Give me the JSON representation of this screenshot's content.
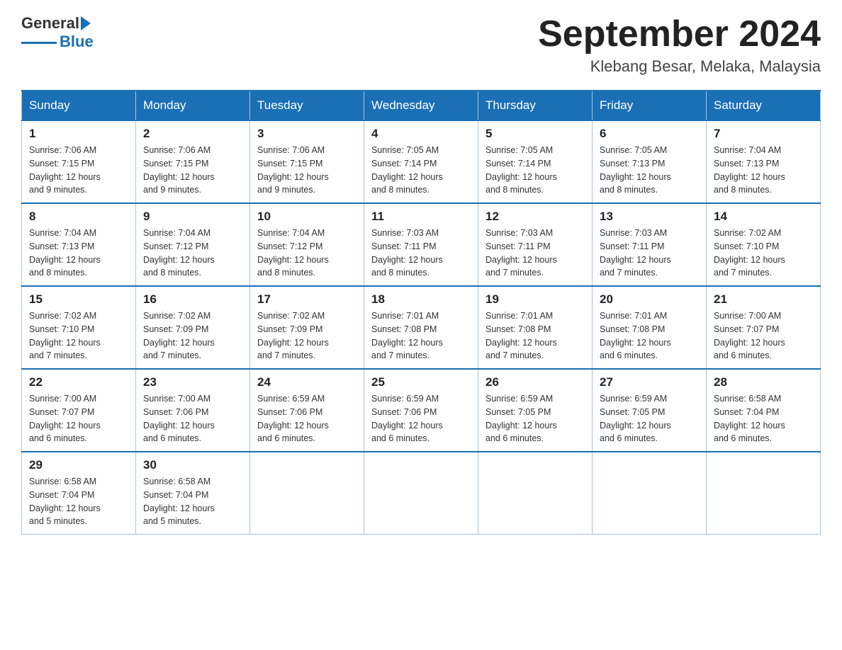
{
  "header": {
    "logo_text_black": "General",
    "logo_text_blue": "Blue",
    "month_title": "September 2024",
    "location": "Klebang Besar, Melaka, Malaysia"
  },
  "days_of_week": [
    "Sunday",
    "Monday",
    "Tuesday",
    "Wednesday",
    "Thursday",
    "Friday",
    "Saturday"
  ],
  "weeks": [
    [
      {
        "day": "1",
        "sunrise": "7:06 AM",
        "sunset": "7:15 PM",
        "daylight": "12 hours and 9 minutes."
      },
      {
        "day": "2",
        "sunrise": "7:06 AM",
        "sunset": "7:15 PM",
        "daylight": "12 hours and 9 minutes."
      },
      {
        "day": "3",
        "sunrise": "7:06 AM",
        "sunset": "7:15 PM",
        "daylight": "12 hours and 9 minutes."
      },
      {
        "day": "4",
        "sunrise": "7:05 AM",
        "sunset": "7:14 PM",
        "daylight": "12 hours and 8 minutes."
      },
      {
        "day": "5",
        "sunrise": "7:05 AM",
        "sunset": "7:14 PM",
        "daylight": "12 hours and 8 minutes."
      },
      {
        "day": "6",
        "sunrise": "7:05 AM",
        "sunset": "7:13 PM",
        "daylight": "12 hours and 8 minutes."
      },
      {
        "day": "7",
        "sunrise": "7:04 AM",
        "sunset": "7:13 PM",
        "daylight": "12 hours and 8 minutes."
      }
    ],
    [
      {
        "day": "8",
        "sunrise": "7:04 AM",
        "sunset": "7:13 PM",
        "daylight": "12 hours and 8 minutes."
      },
      {
        "day": "9",
        "sunrise": "7:04 AM",
        "sunset": "7:12 PM",
        "daylight": "12 hours and 8 minutes."
      },
      {
        "day": "10",
        "sunrise": "7:04 AM",
        "sunset": "7:12 PM",
        "daylight": "12 hours and 8 minutes."
      },
      {
        "day": "11",
        "sunrise": "7:03 AM",
        "sunset": "7:11 PM",
        "daylight": "12 hours and 8 minutes."
      },
      {
        "day": "12",
        "sunrise": "7:03 AM",
        "sunset": "7:11 PM",
        "daylight": "12 hours and 7 minutes."
      },
      {
        "day": "13",
        "sunrise": "7:03 AM",
        "sunset": "7:11 PM",
        "daylight": "12 hours and 7 minutes."
      },
      {
        "day": "14",
        "sunrise": "7:02 AM",
        "sunset": "7:10 PM",
        "daylight": "12 hours and 7 minutes."
      }
    ],
    [
      {
        "day": "15",
        "sunrise": "7:02 AM",
        "sunset": "7:10 PM",
        "daylight": "12 hours and 7 minutes."
      },
      {
        "day": "16",
        "sunrise": "7:02 AM",
        "sunset": "7:09 PM",
        "daylight": "12 hours and 7 minutes."
      },
      {
        "day": "17",
        "sunrise": "7:02 AM",
        "sunset": "7:09 PM",
        "daylight": "12 hours and 7 minutes."
      },
      {
        "day": "18",
        "sunrise": "7:01 AM",
        "sunset": "7:08 PM",
        "daylight": "12 hours and 7 minutes."
      },
      {
        "day": "19",
        "sunrise": "7:01 AM",
        "sunset": "7:08 PM",
        "daylight": "12 hours and 7 minutes."
      },
      {
        "day": "20",
        "sunrise": "7:01 AM",
        "sunset": "7:08 PM",
        "daylight": "12 hours and 6 minutes."
      },
      {
        "day": "21",
        "sunrise": "7:00 AM",
        "sunset": "7:07 PM",
        "daylight": "12 hours and 6 minutes."
      }
    ],
    [
      {
        "day": "22",
        "sunrise": "7:00 AM",
        "sunset": "7:07 PM",
        "daylight": "12 hours and 6 minutes."
      },
      {
        "day": "23",
        "sunrise": "7:00 AM",
        "sunset": "7:06 PM",
        "daylight": "12 hours and 6 minutes."
      },
      {
        "day": "24",
        "sunrise": "6:59 AM",
        "sunset": "7:06 PM",
        "daylight": "12 hours and 6 minutes."
      },
      {
        "day": "25",
        "sunrise": "6:59 AM",
        "sunset": "7:06 PM",
        "daylight": "12 hours and 6 minutes."
      },
      {
        "day": "26",
        "sunrise": "6:59 AM",
        "sunset": "7:05 PM",
        "daylight": "12 hours and 6 minutes."
      },
      {
        "day": "27",
        "sunrise": "6:59 AM",
        "sunset": "7:05 PM",
        "daylight": "12 hours and 6 minutes."
      },
      {
        "day": "28",
        "sunrise": "6:58 AM",
        "sunset": "7:04 PM",
        "daylight": "12 hours and 6 minutes."
      }
    ],
    [
      {
        "day": "29",
        "sunrise": "6:58 AM",
        "sunset": "7:04 PM",
        "daylight": "12 hours and 5 minutes."
      },
      {
        "day": "30",
        "sunrise": "6:58 AM",
        "sunset": "7:04 PM",
        "daylight": "12 hours and 5 minutes."
      },
      null,
      null,
      null,
      null,
      null
    ]
  ],
  "labels": {
    "sunrise": "Sunrise:",
    "sunset": "Sunset:",
    "daylight": "Daylight:"
  }
}
